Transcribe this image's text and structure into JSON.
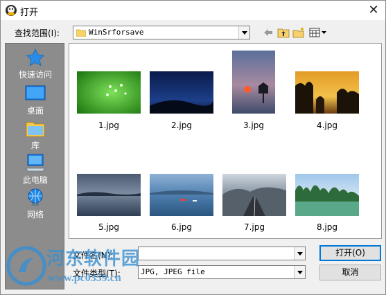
{
  "window": {
    "title": "打开",
    "close_symbol": "✕"
  },
  "lookin": {
    "label": "查找范围(I):",
    "value": "WinSrforsave"
  },
  "toolbar": {
    "icons": [
      "back-arrow-icon",
      "up-folder-icon",
      "new-folder-icon",
      "view-menu-icon"
    ]
  },
  "places": [
    {
      "label": "快速访问",
      "icon": "star-icon"
    },
    {
      "label": "桌面",
      "icon": "desktop-icon"
    },
    {
      "label": "库",
      "icon": "library-icon"
    },
    {
      "label": "此电脑",
      "icon": "computer-icon"
    },
    {
      "label": "网络",
      "icon": "network-icon"
    }
  ],
  "files": [
    {
      "name": "1.jpg"
    },
    {
      "name": "2.jpg"
    },
    {
      "name": "3.jpg"
    },
    {
      "name": "4.jpg"
    },
    {
      "name": "5.jpg"
    },
    {
      "name": "6.jpg"
    },
    {
      "name": "7.jpg"
    },
    {
      "name": "8.jpg"
    }
  ],
  "filename": {
    "label": "文件名(N):",
    "value": ""
  },
  "filetype": {
    "label": "文件类型(T):",
    "value": "JPG, JPEG file"
  },
  "buttons": {
    "open": "打开(O)",
    "cancel": "取消"
  },
  "watermark": {
    "title": "河东软件园",
    "url": "www.pc0359.cn"
  }
}
